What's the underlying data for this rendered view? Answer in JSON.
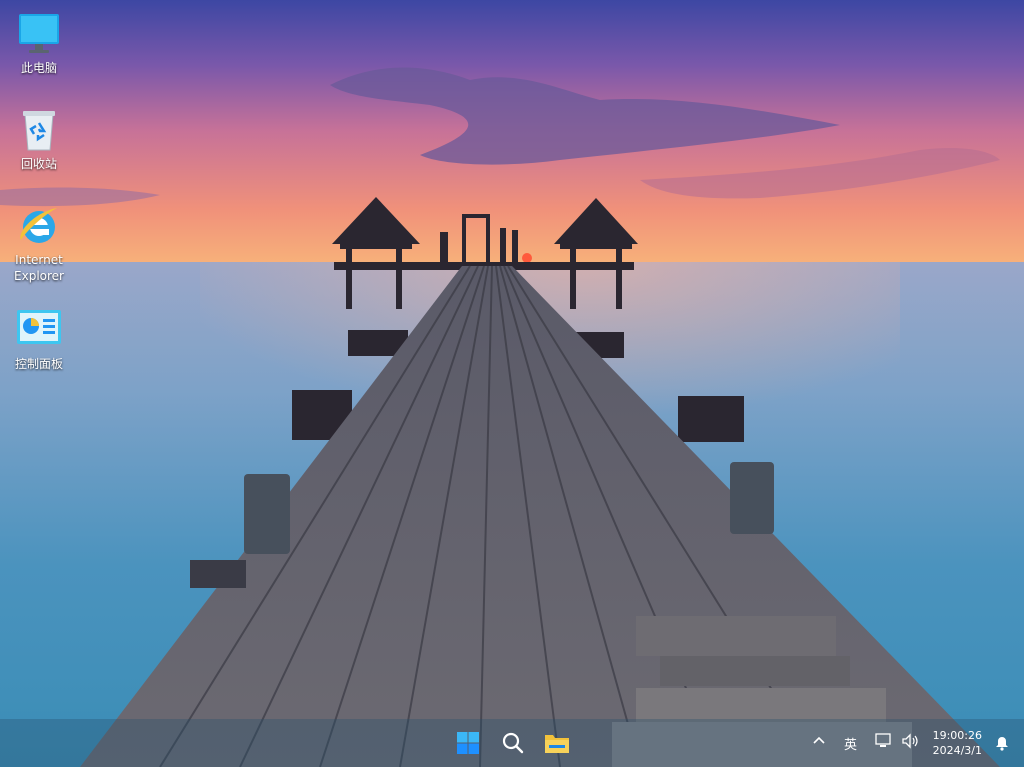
{
  "desktop": {
    "icons": [
      {
        "label": "此电脑",
        "icon": "this-pc-icon"
      },
      {
        "label": "回收站",
        "icon": "recycle-bin-icon"
      },
      {
        "label": "Internet\nExplorer",
        "icon": "internet-explorer-icon"
      },
      {
        "label": "控制面板",
        "icon": "control-panel-icon"
      }
    ]
  },
  "taskbar": {
    "pinned": [
      {
        "name": "start",
        "icon": "windows-start-icon"
      },
      {
        "name": "search",
        "icon": "search-icon"
      },
      {
        "name": "file-explorer",
        "icon": "folder-icon"
      }
    ],
    "tray": {
      "chevron_icon": "chevron-up-icon",
      "ime_label": "英",
      "network_icon": "network-icon",
      "volume_icon": "volume-icon",
      "time": "19:00:26",
      "date": "2024/3/1",
      "notification_icon": "notification-icon"
    }
  },
  "colors": {
    "accent_blue": "#1E90FF",
    "folder_yellow": "#F2C23A"
  }
}
